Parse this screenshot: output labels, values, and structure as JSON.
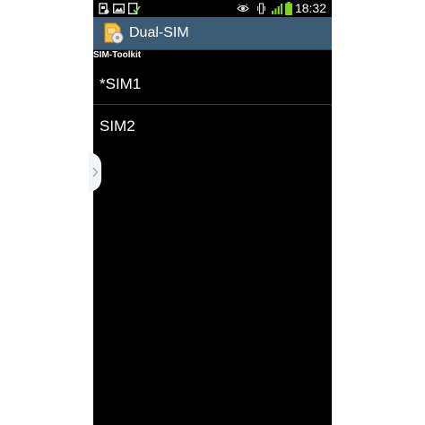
{
  "status_bar": {
    "time": "18:32",
    "left_icons": [
      "sim-toolkit-icon",
      "gallery-icon",
      "download-check-icon"
    ],
    "right_icons": [
      "eye-icon",
      "vibrate-icon",
      "signal-icon",
      "battery-icon"
    ]
  },
  "action_bar": {
    "title": "Dual-SIM",
    "app_icon": "dual-sim-app-icon"
  },
  "section_label": "SIM-Toolkit",
  "list": {
    "items": [
      {
        "label": "*SIM1"
      },
      {
        "label": "SIM2"
      }
    ]
  },
  "drawer_handle": {
    "icon": "chevron-right-icon"
  },
  "colors": {
    "action_bar_bg": "#3b5a73",
    "screen_bg": "#000000",
    "battery": "#7ed321",
    "signal": "#7ed321"
  }
}
